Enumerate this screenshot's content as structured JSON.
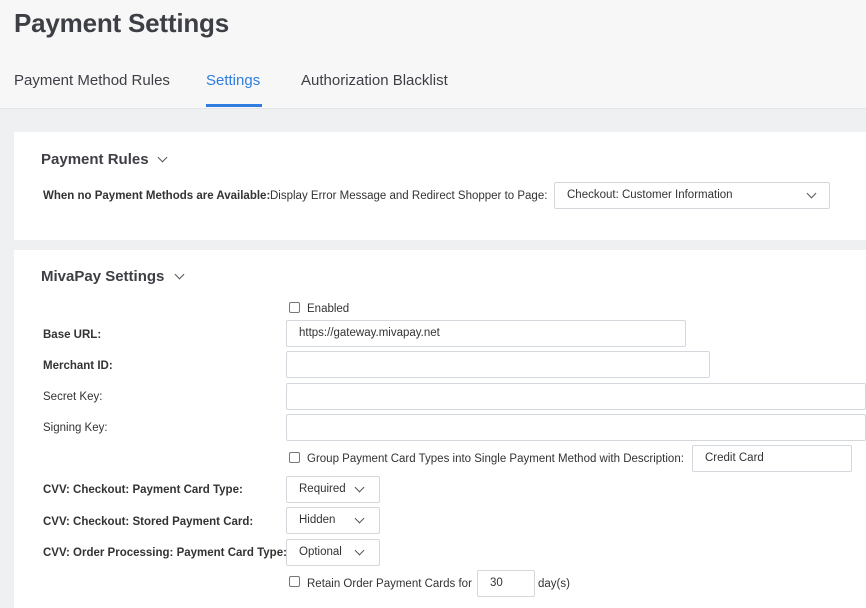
{
  "page": {
    "title": "Payment Settings"
  },
  "tabs": [
    {
      "label": "Payment Method Rules"
    },
    {
      "label": "Settings"
    },
    {
      "label": "Authorization Blacklist"
    }
  ],
  "payment_rules": {
    "title": "Payment Rules",
    "no_methods_label": "When no Payment Methods are Available:",
    "no_methods_text": "Display Error Message and Redirect Shopper to Page:",
    "redirect_page": "Checkout: Customer Information"
  },
  "mivapay": {
    "title": "MivaPay Settings",
    "enabled_label": "Enabled",
    "base_url_label": "Base URL:",
    "base_url_value": "https://gateway.mivapay.net",
    "merchant_id_label": "Merchant ID:",
    "merchant_id_value": "",
    "secret_key_label": "Secret Key:",
    "secret_key_value": "",
    "signing_key_label": "Signing Key:",
    "signing_key_value": "",
    "group_label": "Group Payment Card Types into Single Payment Method with Description:",
    "group_value": "Credit Card",
    "cvv_checkout_card_label": "CVV: Checkout: Payment Card Type:",
    "cvv_checkout_card_value": "Required",
    "cvv_checkout_stored_label": "CVV: Checkout: Stored Payment Card:",
    "cvv_checkout_stored_value": "Hidden",
    "cvv_order_label": "CVV: Order Processing: Payment Card Type:",
    "cvv_order_value": "Optional",
    "retain_label": "Retain Order Payment Cards for",
    "retain_value": "30",
    "retain_unit": "day(s)"
  }
}
